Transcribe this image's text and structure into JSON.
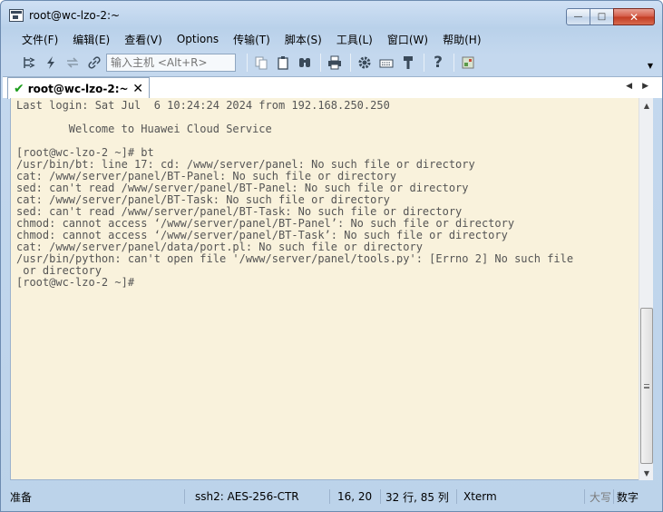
{
  "window": {
    "title": "root@wc-lzo-2:~",
    "minimize": "—",
    "maximize": "□",
    "close": "✕"
  },
  "menu": [
    "文件(F)",
    "编辑(E)",
    "查看(V)",
    "Options",
    "传输(T)",
    "脚本(S)",
    "工具(L)",
    "窗口(W)",
    "帮助(H)"
  ],
  "toolbar": {
    "host_placeholder": "输入主机 <Alt+R>",
    "icons": [
      "connect-icon",
      "lightning-icon",
      "reconnect-icon",
      "link-icon",
      "copy-icon",
      "paste-icon",
      "find-icon",
      "print-icon",
      "settings-icon",
      "keymap-icon",
      "sftp-icon",
      "help-icon",
      "map-icon"
    ],
    "overflow": "▼"
  },
  "tab": {
    "check": "✔",
    "label": "root@wc-lzo-2:~",
    "close": "✕",
    "nav_left": "◀",
    "nav_right": "▶"
  },
  "terminal": {
    "lines": [
      "Last login: Sat Jul  6 10:24:24 2024 from 192.168.250.250",
      "",
      "        Welcome to Huawei Cloud Service",
      "",
      "[root@wc-lzo-2 ~]# bt",
      "/usr/bin/bt: line 17: cd: /www/server/panel: No such file or directory",
      "cat: /www/server/panel/BT-Panel: No such file or directory",
      "sed: can't read /www/server/panel/BT-Panel: No such file or directory",
      "cat: /www/server/panel/BT-Task: No such file or directory",
      "sed: can't read /www/server/panel/BT-Task: No such file or directory",
      "chmod: cannot access ‘/www/server/panel/BT-Panel’: No such file or directory",
      "chmod: cannot access ‘/www/server/panel/BT-Task’: No such file or directory",
      "cat: /www/server/panel/data/port.pl: No such file or directory",
      "/usr/bin/python: can't open file '/www/server/panel/tools.py': [Errno 2] No such file",
      " or directory",
      "[root@wc-lzo-2 ~]# "
    ]
  },
  "scrollbar": {
    "up": "▲",
    "down": "▼"
  },
  "status": {
    "ready": "准备",
    "protocol": "ssh2: AES-256-CTR",
    "cursor": "16,  20",
    "size": "32 行, 85 列",
    "term": "Xterm",
    "caps": "大写",
    "num": "数字"
  }
}
